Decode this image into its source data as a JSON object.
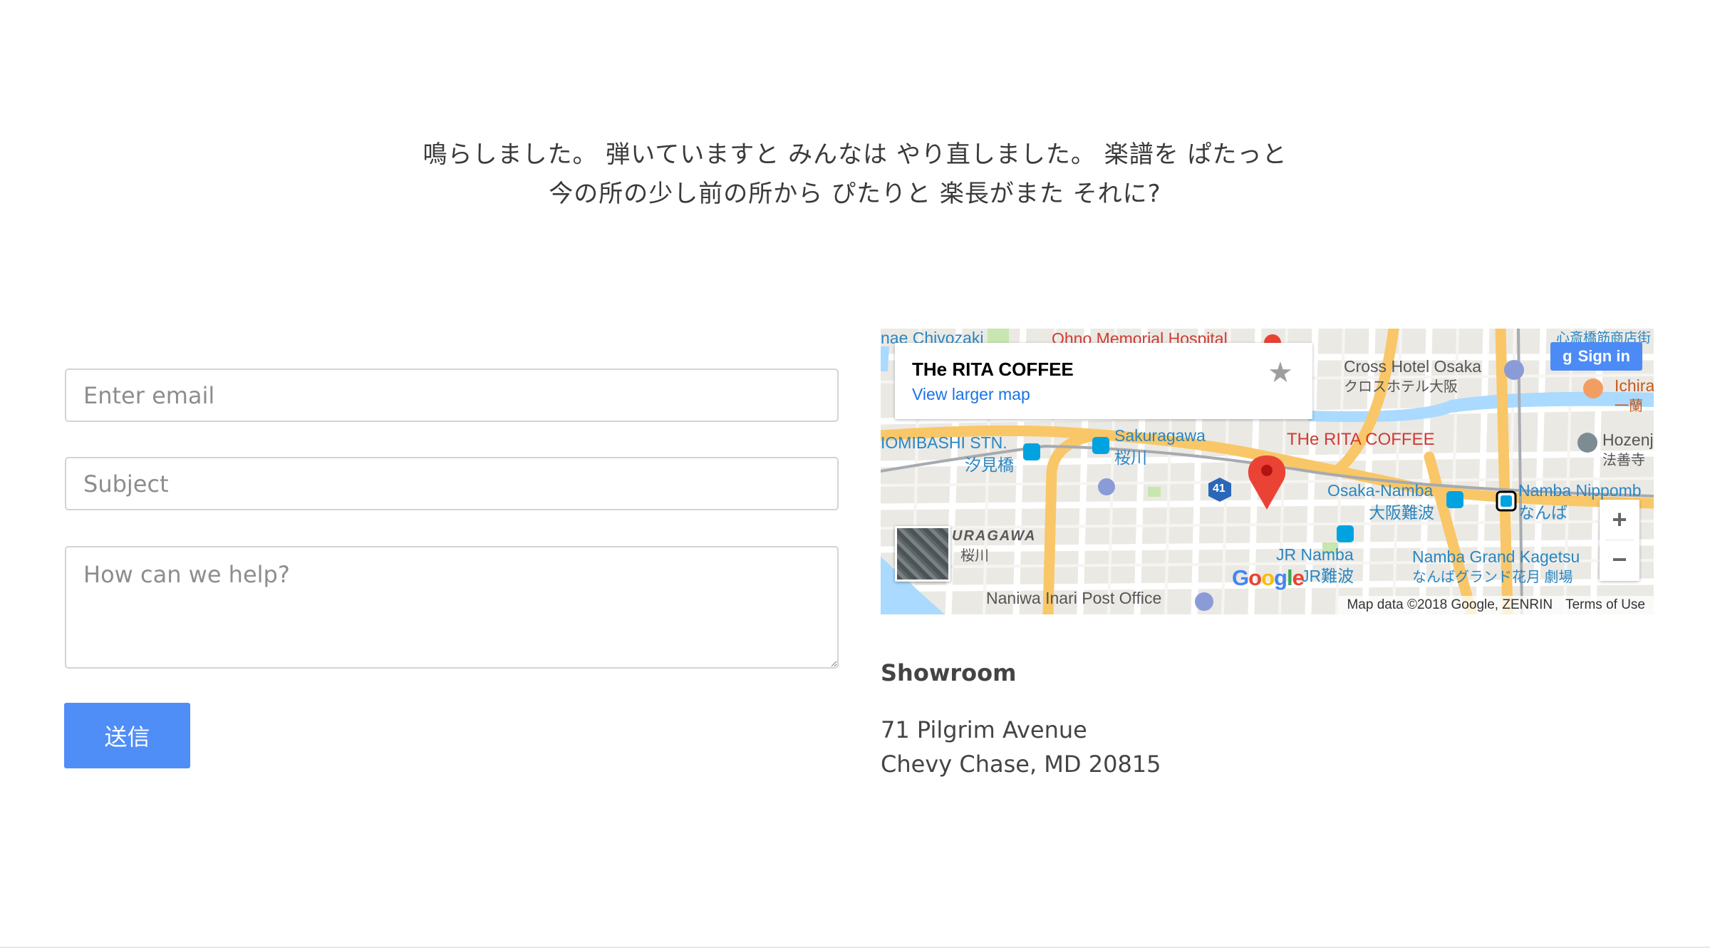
{
  "intro": {
    "line1": "鳴らしました。 弾いていますと みんなは やり直しました。 楽譜を ぱたっと",
    "line2": "今の所の少し前の所から ぴたりと 楽長がまた それに?"
  },
  "form": {
    "email_placeholder": "Enter email",
    "subject_placeholder": "Subject",
    "message_placeholder": "How can we help?",
    "submit_label": "送信"
  },
  "map": {
    "place_name": "THe RITA COFFEE",
    "view_larger_label": "View larger map",
    "sign_in_label": "Sign in",
    "zoom_in_label": "+",
    "zoom_out_label": "−",
    "attribution": "Map data ©2018 Google, ZENRIN",
    "terms_label": "Terms of Use",
    "google_logo": [
      "G",
      "o",
      "o",
      "g",
      "l",
      "e"
    ],
    "labels": {
      "chivozaki": "nae Chivozaki",
      "ohno": "Ohno Memorial Hospital",
      "shinsaibashi": "心斎橋筋商店街",
      "cross_hotel_en": "Cross Hotel Osaka",
      "cross_hotel_ja": "クロスホテル大阪",
      "ichiran_en": "Ichira",
      "ichiran_ja": "一蘭",
      "iomibashi_en": "IOMIBASHI STN.",
      "iomibashi_ja": "汐見橋",
      "sakuragawa_en": "Sakuragawa",
      "sakuragawa_ja": "桜川",
      "rita_pin": "THe RITA COFFEE",
      "hozenji_en": "Hozenj",
      "hozenji_ja": "法善寺",
      "route_41": "41",
      "osaka_namba_en": "Osaka-Namba",
      "osaka_namba_ja": "大阪難波",
      "namba_nippombashi_en": "Namba Nippomb",
      "namba_nippombashi_ja": "なんば",
      "sakuragawa_area_en": "URAGAWA",
      "sakuragawa_area_ja": "桜川",
      "jr_namba_en": "JR Namba",
      "jr_namba_ja": "JR難波",
      "namba_grand_en": "Namba Grand Kagetsu",
      "namba_grand_ja": "なんばグランド花月 劇場",
      "naniwa_post": "Naniwa Inari Post Office"
    },
    "colors": {
      "major_road": "#f9c767",
      "water": "#aadaff",
      "park": "#c8e6b0",
      "pin": "#ea4335"
    }
  },
  "showroom": {
    "title": "Showroom",
    "address_line1": "71 Pilgrim Avenue",
    "address_line2": "Chevy Chase, MD 20815"
  }
}
